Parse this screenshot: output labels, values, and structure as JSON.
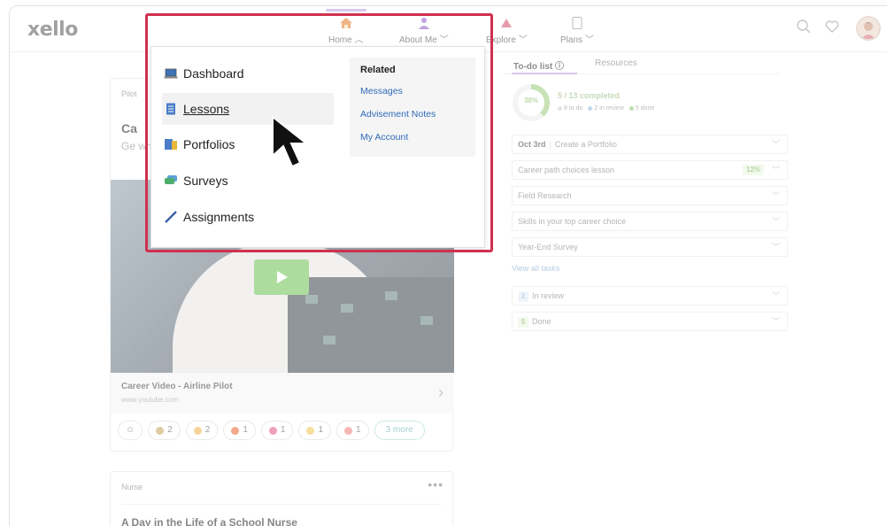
{
  "app": {
    "logo": "xello"
  },
  "nav": {
    "items": [
      {
        "label": "Home",
        "icon": "home-icon",
        "color": "#e07b26",
        "chevron": "up"
      },
      {
        "label": "About Me",
        "icon": "person-icon",
        "color": "#8b56c8",
        "chevron": "down"
      },
      {
        "label": "Explore",
        "icon": "explore-icon",
        "color": "#d84a6b",
        "chevron": "down"
      },
      {
        "label": "Plans",
        "icon": "clipboard-icon",
        "color": "#888888",
        "chevron": "down"
      }
    ]
  },
  "menu": {
    "items": [
      {
        "label": "Dashboard",
        "icon": "laptop-icon"
      },
      {
        "label": "Lessons",
        "icon": "notebook-icon",
        "hovered": true
      },
      {
        "label": "Portfolios",
        "icon": "portfolio-icon"
      },
      {
        "label": "Surveys",
        "icon": "chat-bubbles-icon"
      },
      {
        "label": "Assignments",
        "icon": "pencil-icon"
      }
    ],
    "related": {
      "heading": "Related",
      "links": [
        "Messages",
        "Advisement Notes",
        "My Account"
      ]
    }
  },
  "feed": {
    "card1": {
      "kicker": "Pilot",
      "title": "Ca",
      "desc": "Ge wh",
      "video_title": "Career Video - Airline Pilot",
      "video_url": "www.youtube.com",
      "reactions": [
        {
          "count": "2",
          "color": "#c6a05a"
        },
        {
          "count": "2",
          "color": "#f0b04a"
        },
        {
          "count": "1",
          "color": "#e8652a"
        },
        {
          "count": "1",
          "color": "#e2527a"
        },
        {
          "count": "1",
          "color": "#f0c24a"
        },
        {
          "count": "1",
          "color": "#f07a7a"
        }
      ],
      "more_label": "3 more"
    },
    "card2": {
      "kicker": "Nurse",
      "more": "•••",
      "title": "A Day in the Life of a School Nurse"
    }
  },
  "todo": {
    "tabs": [
      "To-do list ⓘ",
      "Resources"
    ],
    "progress_percent": 38,
    "progress_label": "38%",
    "completed_text": "5 / 13 completed",
    "legend": [
      {
        "label": "8 to do",
        "color": "#cfcfcf"
      },
      {
        "label": "2 in review",
        "color": "#8fb3e0"
      },
      {
        "label": "5 done",
        "color": "#8bc36a"
      }
    ],
    "tasks": [
      {
        "date": "Oct 3rd",
        "label": "Create a Portfolio",
        "pct": ""
      },
      {
        "date": "",
        "label": "Career path choices lesson",
        "pct": "12%"
      },
      {
        "date": "",
        "label": "Field Research",
        "pct": ""
      },
      {
        "date": "",
        "label": "Skills in your top career choice",
        "pct": ""
      },
      {
        "date": "",
        "label": "Year-End Survey",
        "pct": ""
      }
    ],
    "view_all": "View all tasks",
    "groups": [
      {
        "count": "2",
        "label": "In review",
        "color": "#8fb3e0",
        "bg": "#e4edf8"
      },
      {
        "count": "5",
        "label": "Done",
        "color": "#7fb35d",
        "bg": "#e8f4de"
      }
    ]
  }
}
